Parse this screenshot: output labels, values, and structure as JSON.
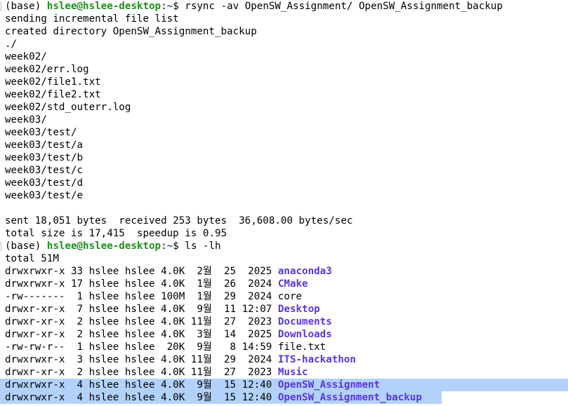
{
  "prompt": {
    "base": "(base)",
    "user_host": "hslee@hslee-desktop",
    "path": "~"
  },
  "rsync": {
    "command": "rsync -av OpenSW_Assignment/ OpenSW_Assignment_backup",
    "output": [
      "sending incremental file list",
      "created directory OpenSW_Assignment_backup",
      "./",
      "week02/",
      "week02/err.log",
      "week02/file1.txt",
      "week02/file2.txt",
      "week02/std_outerr.log",
      "week03/",
      "week03/test/",
      "week03/test/a",
      "week03/test/b",
      "week03/test/c",
      "week03/test/d",
      "week03/test/e",
      "",
      "sent 18,051 bytes  received 253 bytes  36,608.00 bytes/sec",
      "total size is 17,415  speedup is 0.95"
    ]
  },
  "ls": {
    "command": "ls -lh",
    "total": "total 51M",
    "entries": [
      {
        "prefix": "drwxrwxr-x 33 hslee hslee 4.0K  2월  25  2025 ",
        "name": "anaconda3",
        "is_dir": true,
        "highlighted": false
      },
      {
        "prefix": "drwxrwxr-x 17 hslee hslee 4.0K  1월  26  2024 ",
        "name": "CMake",
        "is_dir": true,
        "highlighted": false
      },
      {
        "prefix": "-rw-------  1 hslee hslee 100M  1월  29  2024 ",
        "name": "core",
        "is_dir": false,
        "highlighted": false
      },
      {
        "prefix": "drwxr-xr-x  7 hslee hslee 4.0K  9월  11 12:07 ",
        "name": "Desktop",
        "is_dir": true,
        "highlighted": false
      },
      {
        "prefix": "drwxr-xr-x  2 hslee hslee 4.0K 11월  27  2023 ",
        "name": "Documents",
        "is_dir": true,
        "highlighted": false
      },
      {
        "prefix": "drwxr-xr-x  2 hslee hslee 4.0K  3월  14  2025 ",
        "name": "Downloads",
        "is_dir": true,
        "highlighted": false
      },
      {
        "prefix": "-rw-rw-r--  1 hslee hslee  20K  9월   8 14:59 ",
        "name": "file.txt",
        "is_dir": false,
        "highlighted": false
      },
      {
        "prefix": "drwxrwxr-x  3 hslee hslee 4.0K 11월  29  2024 ",
        "name": "ITS-hackathon",
        "is_dir": true,
        "highlighted": false
      },
      {
        "prefix": "drwxr-xr-x  2 hslee hslee 4.0K 11월  27  2023 ",
        "name": "Music",
        "is_dir": true,
        "highlighted": false
      },
      {
        "prefix": "drwxrwxr-x  4 hslee hslee 4.0K  9월  15 12:40 ",
        "name": "OpenSW_Assignment",
        "is_dir": true,
        "highlighted": true
      },
      {
        "prefix": "drwxrwxr-x  4 hslee hslee 4.0K  9월  15 12:40 ",
        "name": "OpenSW_Assignment_backup",
        "is_dir": true,
        "highlighted": true
      }
    ]
  },
  "colors": {
    "background": "#ffffff",
    "prompt_user": "#1c8f1c",
    "prompt_path": "#3b41d9",
    "directory": "#5a35d9",
    "selection": "#b9d6fb"
  }
}
